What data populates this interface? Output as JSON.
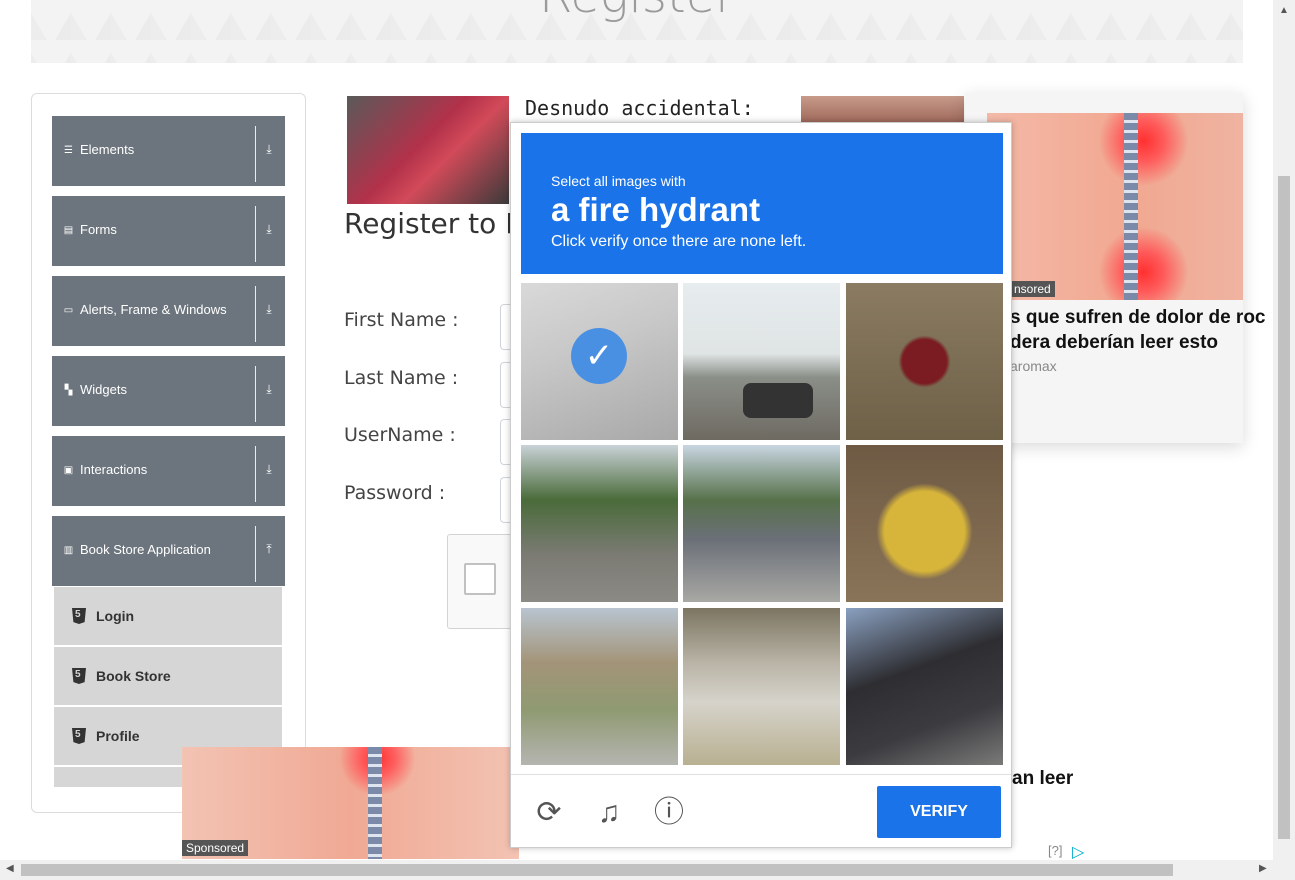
{
  "banner": {
    "title": "Register"
  },
  "sidebar": {
    "groups": [
      {
        "label": "Elements",
        "icon": "hamburger-icon",
        "arrow": "download-icon"
      },
      {
        "label": "Forms",
        "icon": "form-icon",
        "arrow": "download-icon"
      },
      {
        "label": "Alerts, Frame & Windows",
        "icon": "window-icon",
        "arrow": "download-icon"
      },
      {
        "label": "Widgets",
        "icon": "widgets-icon",
        "arrow": "download-icon"
      },
      {
        "label": "Interactions",
        "icon": "interactions-icon",
        "arrow": "download-icon"
      },
      {
        "label": "Book Store Application",
        "icon": "books-icon",
        "arrow": "upload-icon"
      }
    ],
    "items": [
      {
        "label": "Login"
      },
      {
        "label": "Book Store"
      },
      {
        "label": "Profile"
      }
    ]
  },
  "main": {
    "ad_headline": "Desnudo accidental: Las",
    "register_title": "Register to B",
    "labels": {
      "first_name": "First Name :",
      "last_name": "Last Name :",
      "username": "UserName :",
      "password": "Password :"
    }
  },
  "ad_right": {
    "sponsored": "nsored",
    "text_line1": "s que sufren de dolor de roc",
    "text_line2": "dera deberían leer esto",
    "source": "aromax"
  },
  "ad_bottom": {
    "sponsored": "Sponsored",
    "text": "an leer",
    "qmark": "[?]"
  },
  "captcha": {
    "line1": "Select all images with",
    "line2": "a fire hydrant",
    "line3": "Click verify once there are none left.",
    "verify": "VERIFY",
    "tiles": [
      {
        "name": "tile-1",
        "selected": true
      },
      {
        "name": "tile-2",
        "selected": false
      },
      {
        "name": "tile-3",
        "selected": false
      },
      {
        "name": "tile-4",
        "selected": false
      },
      {
        "name": "tile-5",
        "selected": false
      },
      {
        "name": "tile-6",
        "selected": false
      },
      {
        "name": "tile-7",
        "selected": false
      },
      {
        "name": "tile-8",
        "selected": false
      },
      {
        "name": "tile-9",
        "selected": false
      }
    ]
  },
  "colors": {
    "accent": "#1a73e8",
    "sidebar_group": "#6c757d",
    "sidebar_item": "#d6d6d6"
  }
}
